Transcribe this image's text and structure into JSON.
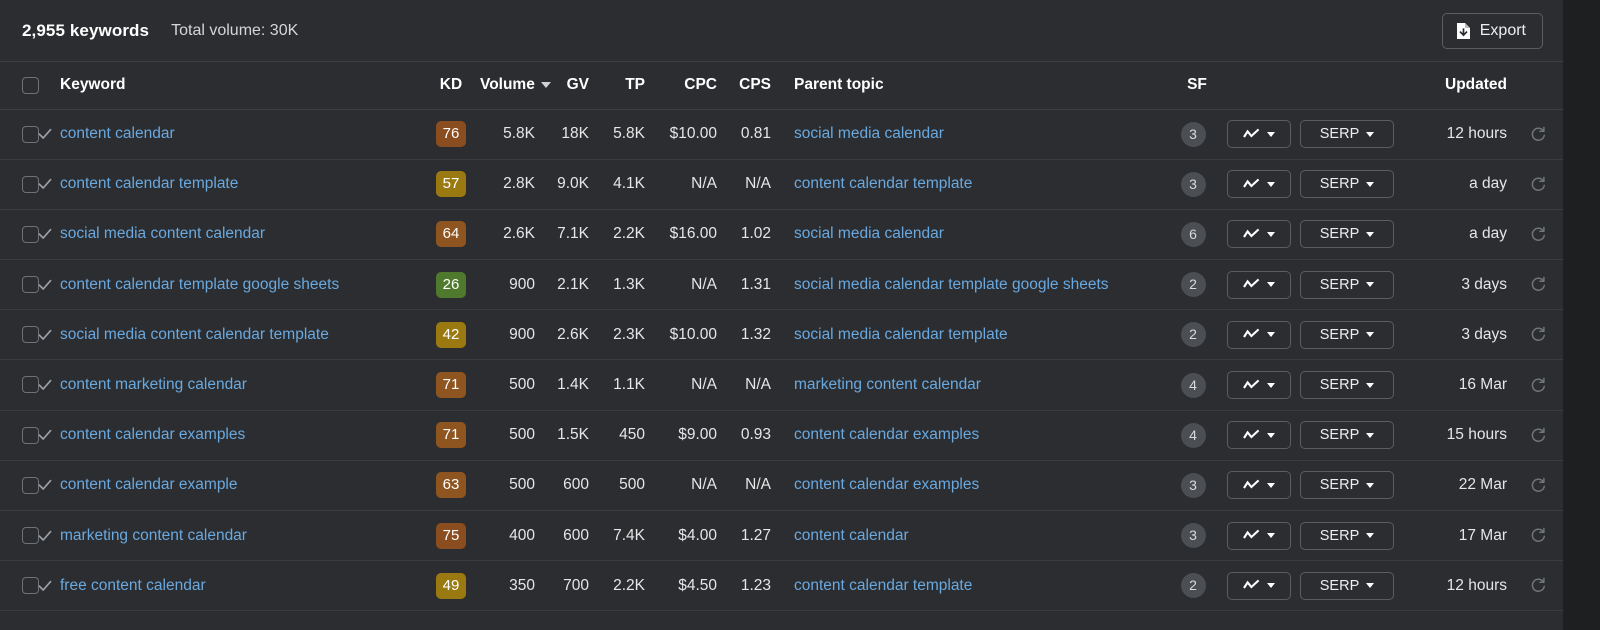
{
  "topbar": {
    "keyword_count": "2,955 keywords",
    "total_volume": "Total volume: 30K",
    "export_label": "Export",
    "export_icon": "file-download-icon"
  },
  "table": {
    "columns": {
      "keyword": "Keyword",
      "kd": "KD",
      "volume": "Volume",
      "gv": "GV",
      "tp": "TP",
      "cpc": "CPC",
      "cps": "CPS",
      "parent_topic": "Parent topic",
      "sf": "SF",
      "updated": "Updated"
    },
    "sort": {
      "column": "Volume",
      "direction": "desc"
    },
    "row_buttons": {
      "serp_label": "SERP",
      "chart_icon": "sparkline-icon",
      "refresh_icon": "refresh-icon"
    },
    "kd_colors": {
      "green": "#4f7a2e",
      "olive": "#9a7a10",
      "orange": "#8f5520",
      "brown": "#8a4d1f"
    },
    "rows": [
      {
        "keyword": "content calendar",
        "kd": "76",
        "kd_color": "#8a4d1f",
        "volume": "5.8K",
        "gv": "18K",
        "tp": "5.8K",
        "cpc": "$10.00",
        "cps": "0.81",
        "parent_topic": "social media calendar",
        "sf": "3",
        "serp": "SERP",
        "updated": "12 hours"
      },
      {
        "keyword": "content calendar template",
        "kd": "57",
        "kd_color": "#9a7a10",
        "volume": "2.8K",
        "gv": "9.0K",
        "tp": "4.1K",
        "cpc": "N/A",
        "cps": "N/A",
        "parent_topic": "content calendar template",
        "sf": "3",
        "serp": "SERP",
        "updated": "a day"
      },
      {
        "keyword": "social media content calendar",
        "kd": "64",
        "kd_color": "#8f5520",
        "volume": "2.6K",
        "gv": "7.1K",
        "tp": "2.2K",
        "cpc": "$16.00",
        "cps": "1.02",
        "parent_topic": "social media calendar",
        "sf": "6",
        "serp": "SERP",
        "updated": "a day"
      },
      {
        "keyword": "content calendar template google sheets",
        "kd": "26",
        "kd_color": "#4f7a2e",
        "volume": "900",
        "gv": "2.1K",
        "tp": "1.3K",
        "cpc": "N/A",
        "cps": "1.31",
        "parent_topic": "social media calendar template google sheets",
        "sf": "2",
        "serp": "SERP",
        "updated": "3 days"
      },
      {
        "keyword": "social media content calendar template",
        "kd": "42",
        "kd_color": "#9a7a10",
        "volume": "900",
        "gv": "2.6K",
        "tp": "2.3K",
        "cpc": "$10.00",
        "cps": "1.32",
        "parent_topic": "social media calendar template",
        "sf": "2",
        "serp": "SERP",
        "updated": "3 days"
      },
      {
        "keyword": "content marketing calendar",
        "kd": "71",
        "kd_color": "#8f5520",
        "volume": "500",
        "gv": "1.4K",
        "tp": "1.1K",
        "cpc": "N/A",
        "cps": "N/A",
        "parent_topic": "marketing content calendar",
        "sf": "4",
        "serp": "SERP",
        "updated": "16 Mar"
      },
      {
        "keyword": "content calendar examples",
        "kd": "71",
        "kd_color": "#8f5520",
        "volume": "500",
        "gv": "1.5K",
        "tp": "450",
        "cpc": "$9.00",
        "cps": "0.93",
        "parent_topic": "content calendar examples",
        "sf": "4",
        "serp": "SERP",
        "updated": "15 hours"
      },
      {
        "keyword": "content calendar example",
        "kd": "63",
        "kd_color": "#8f5520",
        "volume": "500",
        "gv": "600",
        "tp": "500",
        "cpc": "N/A",
        "cps": "N/A",
        "parent_topic": "content calendar examples",
        "sf": "3",
        "serp": "SERP",
        "updated": "22 Mar"
      },
      {
        "keyword": "marketing content calendar",
        "kd": "75",
        "kd_color": "#8a4d1f",
        "volume": "400",
        "gv": "600",
        "tp": "7.4K",
        "cpc": "$4.00",
        "cps": "1.27",
        "parent_topic": "content calendar",
        "sf": "3",
        "serp": "SERP",
        "updated": "17 Mar"
      },
      {
        "keyword": "free content calendar",
        "kd": "49",
        "kd_color": "#9a7a10",
        "volume": "350",
        "gv": "700",
        "tp": "2.2K",
        "cpc": "$4.50",
        "cps": "1.23",
        "parent_topic": "content calendar template",
        "sf": "2",
        "serp": "SERP",
        "updated": "12 hours"
      }
    ]
  }
}
